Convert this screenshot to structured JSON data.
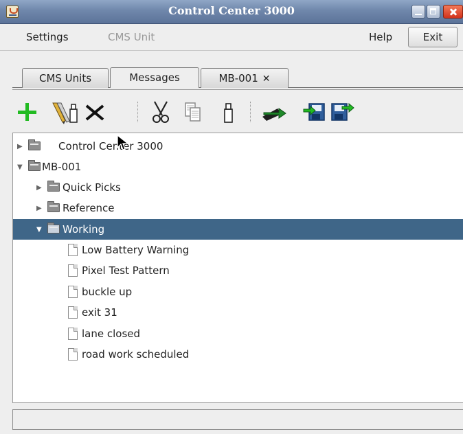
{
  "window": {
    "title": "Control Center 3000"
  },
  "menu": {
    "settings": "Settings",
    "cms_unit": "CMS Unit",
    "help": "Help",
    "exit": "Exit"
  },
  "tabs": [
    {
      "label": "CMS Units"
    },
    {
      "label": "Messages"
    },
    {
      "label": "MB-001",
      "close_glyph": "✕"
    }
  ],
  "toolbar": {
    "icons": [
      "add-icon",
      "edit-icon",
      "delete-icon",
      "cut-icon",
      "copy-icon",
      "paste-icon",
      "send-icon",
      "import-icon",
      "export-icon"
    ]
  },
  "tree": {
    "nodes": [
      {
        "label": "Control Center 3000",
        "type": "folder",
        "expanded": false
      },
      {
        "label": "MB-001",
        "type": "folder",
        "expanded": true
      },
      {
        "label": "Quick Picks",
        "type": "folder",
        "expanded": false
      },
      {
        "label": "Reference",
        "type": "folder",
        "expanded": false
      },
      {
        "label": "Working",
        "type": "folder",
        "expanded": true,
        "selected": true
      },
      {
        "label": "Low Battery Warning",
        "type": "message"
      },
      {
        "label": "Pixel Test Pattern",
        "type": "message"
      },
      {
        "label": "buckle up",
        "type": "message"
      },
      {
        "label": "exit 31",
        "type": "message"
      },
      {
        "label": "lane closed",
        "type": "message"
      },
      {
        "label": "road work scheduled",
        "type": "message"
      }
    ],
    "toggle_collapsed": "▶",
    "toggle_expanded": "▼"
  },
  "colors": {
    "titlebar": "#6f87ab",
    "selection": "#3f6688",
    "add_green": "#22bb22",
    "send_green": "#1f8a2a"
  },
  "statusbar": {
    "text": ""
  }
}
